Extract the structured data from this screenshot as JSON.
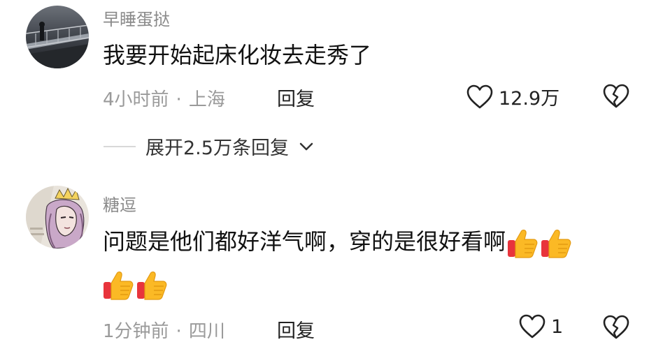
{
  "comments": [
    {
      "username": "早睡蛋挞",
      "text": "我要开始起床化妆去走秀了",
      "time": "4小时前",
      "location": "上海",
      "reply_label": "回复",
      "likes": "12.9万",
      "expand_label": "展开2.5万条回复"
    },
    {
      "username": "糖逗",
      "text": "问题是他们都好洋气啊，穿的是很好看啊",
      "time": "1分钟前",
      "location": "四川",
      "reply_label": "回复",
      "likes": "1",
      "emoji": "thumbs-up-icon",
      "emoji_count_line1": 2,
      "emoji_count_line2": 2
    }
  ],
  "colors": {
    "username": "#8a8a8a",
    "meta": "#9a9a9a",
    "text": "#111111"
  },
  "separator": "·"
}
